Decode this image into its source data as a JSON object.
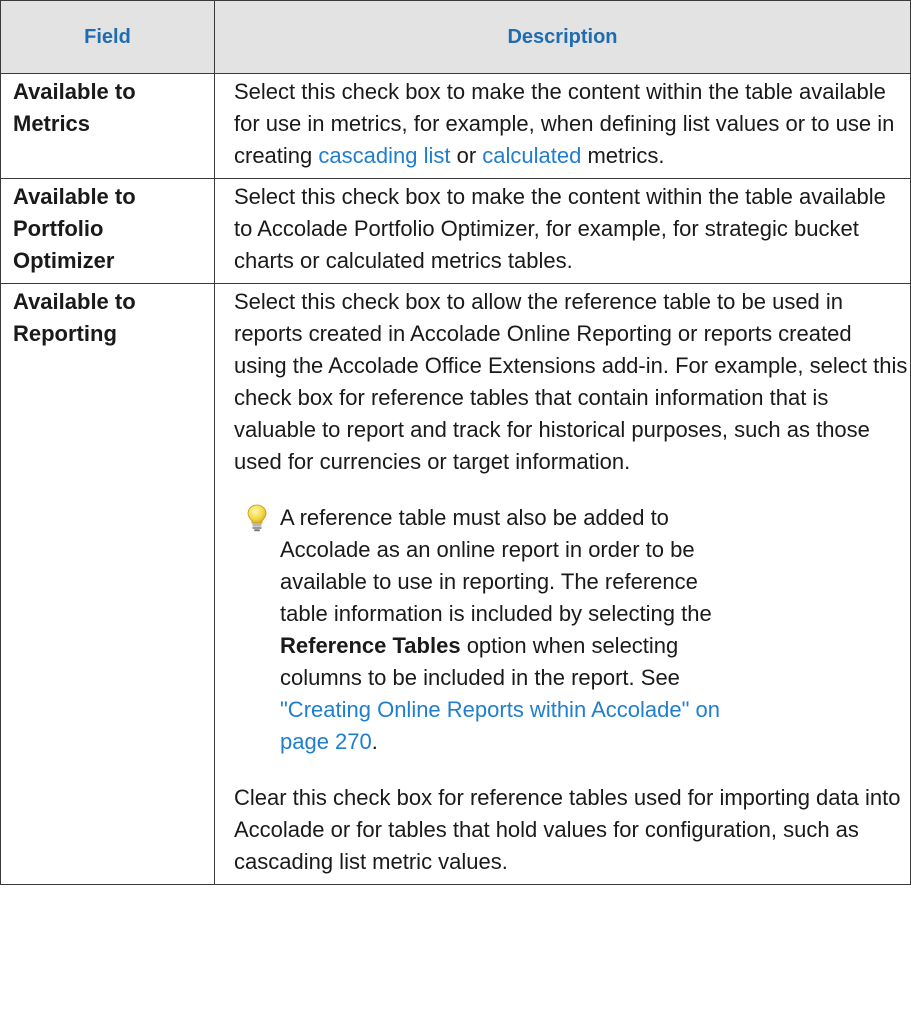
{
  "table": {
    "headers": {
      "field": "Field",
      "description": "Description"
    },
    "rows": [
      {
        "field": "Available to Metrics",
        "desc_before_link1": "Select this check box to make the content within the table available for use in metrics, for example, when defining list values or to use in creating ",
        "link1": "cascading list",
        "desc_between": " or ",
        "link2": "calculated",
        "desc_after": " metrics."
      },
      {
        "field": "Available to Portfolio Optimizer",
        "description": "Select this check box to make the content within the table available to Accolade Portfolio Optimizer, for example, for strategic bucket charts or calculated metrics tables."
      },
      {
        "field": "Available to Reporting",
        "description": "Select this check box to allow the reference table to be used in reports created in Accolade Online Reporting or reports created using the Accolade Office Extensions add-in. For example, select this check box for reference tables that contain information that is valuable to report and track for historical purposes, such as those used for currencies or target information.",
        "tip": {
          "icon": "lightbulb-icon",
          "text_before_bold": "A reference table must also be added to Accolade as an online report in order to be available to use in reporting. The reference table information is included by selecting the ",
          "bold": "Reference Tables",
          "text_after_bold": " option when selecting columns to be included in the report. See ",
          "link": "\"Creating Online Reports within Accolade\" on page 270",
          "text_end": "."
        },
        "clear_text": "Clear this check box for reference tables used for importing data into Accolade or for tables that hold values for configuration, such as cascading list metric values."
      }
    ]
  },
  "colors": {
    "header_text": "#1f6db0",
    "header_bg": "#e3e3e3",
    "link": "#1f7ecf",
    "border": "#3a3a3a"
  }
}
